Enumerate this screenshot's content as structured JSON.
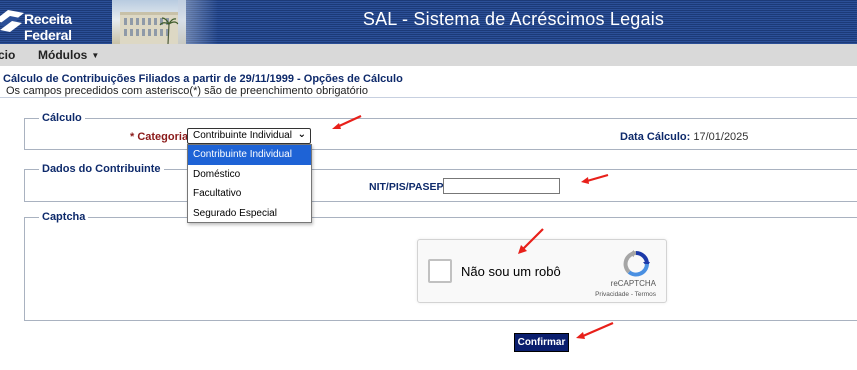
{
  "header": {
    "logo_text": "Receita Federal",
    "app_title": "SAL - Sistema de Acréscimos Legais"
  },
  "menu": {
    "items": [
      {
        "label": "cio"
      },
      {
        "label": "Módulos"
      }
    ]
  },
  "page": {
    "title": "Cálculo de Contribuições Filiados a partir de 29/11/1999 - Opções de Cálculo",
    "subtitle": "Os campos precedidos com asterisco(*) são de preenchimento obrigatório"
  },
  "calculo": {
    "legend": "Cálculo",
    "categoria_label": "* Categoria:",
    "categoria_selected": "Contribuinte Individual",
    "categoria_options": [
      "Contribuinte Individual",
      "Doméstico",
      "Facultativo",
      "Segurado Especial"
    ],
    "data_calculo_label": "Data Cálculo:",
    "data_calculo_value": "17/01/2025"
  },
  "dados": {
    "legend": "Dados do Contribuinte",
    "nit_label": "NIT/PIS/PASEP:",
    "nit_value": ""
  },
  "captcha": {
    "legend": "Captcha",
    "checkbox_text": "Não sou um robô",
    "brand": "reCAPTCHA",
    "links": "Privacidade - Termos"
  },
  "actions": {
    "confirm_label": "Confirmar"
  },
  "colors": {
    "header_blue": "#2b4f97",
    "label_navy": "#0e2a6b",
    "required_red": "#8b1a1a",
    "dropdown_highlight": "#1e63d6",
    "annotation_red": "#e8201a"
  }
}
